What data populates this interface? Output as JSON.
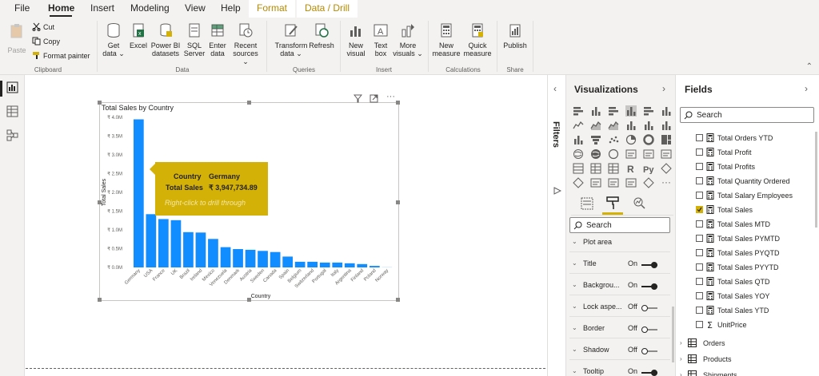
{
  "menu": {
    "tabs": [
      "File",
      "Home",
      "Insert",
      "Modeling",
      "View",
      "Help",
      "Format",
      "Data / Drill"
    ]
  },
  "ribbon": {
    "clipboard": {
      "paste": "Paste",
      "cut": "Cut",
      "copy": "Copy",
      "format_painter": "Format painter",
      "label": "Clipboard"
    },
    "data": {
      "get_data": [
        "Get",
        "data ⌄"
      ],
      "excel": [
        "Excel"
      ],
      "powerbi": [
        "Power BI",
        "datasets"
      ],
      "sql": [
        "SQL",
        "Server"
      ],
      "enter": [
        "Enter",
        "data"
      ],
      "recent": [
        "Recent",
        "sources ⌄"
      ],
      "label": "Data"
    },
    "queries": {
      "transform": [
        "Transform",
        "data ⌄"
      ],
      "refresh": [
        "Refresh"
      ],
      "label": "Queries"
    },
    "insert": {
      "new_visual": [
        "New",
        "visual"
      ],
      "text_box": [
        "Text",
        "box"
      ],
      "more_visuals": [
        "More",
        "visuals ⌄"
      ],
      "label": "Insert"
    },
    "calculations": {
      "new_measure": [
        "New",
        "measure"
      ],
      "quick_measure": [
        "Quick",
        "measure"
      ],
      "label": "Calculations"
    },
    "share": {
      "publish": [
        "Publish"
      ],
      "label": "Share"
    }
  },
  "visual": {
    "title": "Total Sales by Country",
    "tooltip": {
      "country_label": "Country",
      "country_value": "Germany",
      "sales_label": "Total Sales",
      "sales_value": "₹ 3,947,734.89",
      "hint": "Right-click to drill through"
    }
  },
  "chart_data": {
    "type": "bar",
    "title": "Total Sales by Country",
    "xlabel": "Country",
    "ylabel": "Total Sales",
    "categories": [
      "Germany",
      "USA",
      "France",
      "UK",
      "Brazil",
      "Ireland",
      "Mexico",
      "Venezuela",
      "Denmark",
      "Austria",
      "Sweden",
      "Canada",
      "Spain",
      "Belgium",
      "Switzerland",
      "Portugal",
      "Italy",
      "Argentina",
      "Finland",
      "Poland",
      "Norway"
    ],
    "values": [
      3947734.89,
      1420000,
      1290000,
      1260000,
      940000,
      930000,
      760000,
      540000,
      490000,
      470000,
      440000,
      410000,
      290000,
      150000,
      150000,
      130000,
      130000,
      110000,
      90000,
      40000,
      20000
    ],
    "yticks": [
      "₹ 0.0M",
      "₹ 0.5M",
      "₹ 1.0M",
      "₹ 1.5M",
      "₹ 2.0M",
      "₹ 2.5M",
      "₹ 3.0M",
      "₹ 3.5M",
      "₹ 4.0M"
    ],
    "ylim": [
      0,
      4000000
    ],
    "colors": {
      "bar": "#118dff",
      "bar_faded": "#d9ecff"
    },
    "grid": false,
    "legend": "none"
  },
  "filters": {
    "label": "Filters"
  },
  "visualizations": {
    "title": "Visualizations",
    "search_placeholder": "Search",
    "format_sections": [
      {
        "label": "Plot area",
        "state": "",
        "on": null
      },
      {
        "label": "Title",
        "state": "On",
        "on": true
      },
      {
        "label": "Backgrou...",
        "state": "On",
        "on": true
      },
      {
        "label": "Lock aspe...",
        "state": "Off",
        "on": false
      },
      {
        "label": "Border",
        "state": "Off",
        "on": false
      },
      {
        "label": "Shadow",
        "state": "Off",
        "on": false
      },
      {
        "label": "Tooltip",
        "state": "On",
        "on": true
      }
    ]
  },
  "fields": {
    "title": "Fields",
    "search_placeholder": "Search",
    "measures": [
      {
        "label": "Total Orders YTD",
        "checked": false,
        "icon": "calculator-icon"
      },
      {
        "label": "Total Profit",
        "checked": false,
        "icon": "calculator-icon"
      },
      {
        "label": "Total Profits",
        "checked": false,
        "icon": "calculator-icon"
      },
      {
        "label": "Total Quantity Ordered",
        "checked": false,
        "icon": "calculator-icon"
      },
      {
        "label": "Total Salary Employees",
        "checked": false,
        "icon": "calculator-icon"
      },
      {
        "label": "Total Sales",
        "checked": true,
        "icon": "calculator-icon"
      },
      {
        "label": "Total Sales MTD",
        "checked": false,
        "icon": "calculator-icon"
      },
      {
        "label": "Total Sales PYMTD",
        "checked": false,
        "icon": "calculator-icon"
      },
      {
        "label": "Total Sales PYQTD",
        "checked": false,
        "icon": "calculator-icon"
      },
      {
        "label": "Total Sales PYYTD",
        "checked": false,
        "icon": "calculator-icon"
      },
      {
        "label": "Total Sales QTD",
        "checked": false,
        "icon": "calculator-icon"
      },
      {
        "label": "Total Sales YOY",
        "checked": false,
        "icon": "calculator-icon"
      },
      {
        "label": "Total Sales YTD",
        "checked": false,
        "icon": "calculator-icon"
      },
      {
        "label": "UnitPrice",
        "checked": false,
        "icon": "sigma-icon"
      }
    ],
    "tables": [
      "Orders",
      "Products",
      "Shipments"
    ]
  }
}
